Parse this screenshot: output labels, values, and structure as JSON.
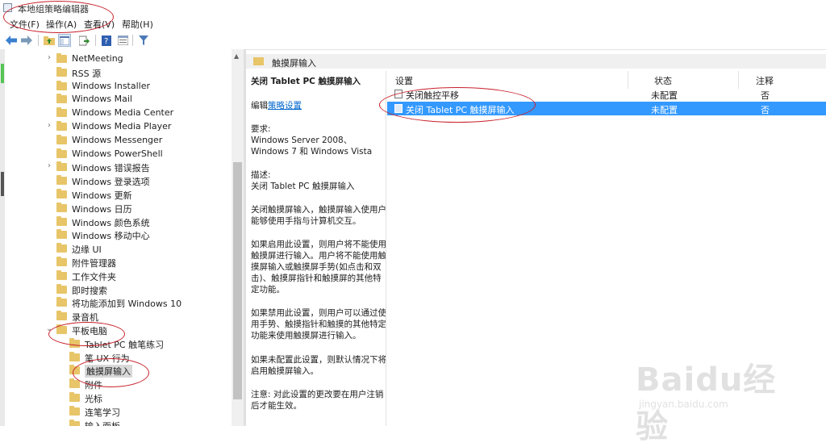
{
  "window": {
    "title": "本地组策略编辑器"
  },
  "menu": [
    "文件(F)",
    "操作(A)",
    "查看(V)",
    "帮助(H)"
  ],
  "toolbar": {
    "icons": [
      "back-arrow-icon",
      "forward-arrow-icon",
      "up-folder-icon",
      "show-tree-icon",
      "export-list-icon",
      "help-icon",
      "properties-icon",
      "filter-icon"
    ]
  },
  "tree": {
    "items": [
      {
        "label": "NetMeeting",
        "expander": "›"
      },
      {
        "label": "RSS 源",
        "expander": ""
      },
      {
        "label": "Windows Installer",
        "expander": ""
      },
      {
        "label": "Windows Mail",
        "expander": ""
      },
      {
        "label": "Windows Media Center",
        "expander": ""
      },
      {
        "label": "Windows Media Player",
        "expander": "›"
      },
      {
        "label": "Windows Messenger",
        "expander": ""
      },
      {
        "label": "Windows PowerShell",
        "expander": ""
      },
      {
        "label": "Windows 错误报告",
        "expander": "›"
      },
      {
        "label": "Windows 登录选项",
        "expander": ""
      },
      {
        "label": "Windows 更新",
        "expander": ""
      },
      {
        "label": "Windows 日历",
        "expander": ""
      },
      {
        "label": "Windows 颜色系统",
        "expander": ""
      },
      {
        "label": "Windows 移动中心",
        "expander": ""
      },
      {
        "label": "边缘 UI",
        "expander": ""
      },
      {
        "label": "附件管理器",
        "expander": ""
      },
      {
        "label": "工作文件夹",
        "expander": ""
      },
      {
        "label": "即时搜索",
        "expander": ""
      },
      {
        "label": "将功能添加到 Windows 10",
        "expander": ""
      },
      {
        "label": "录音机",
        "expander": ""
      },
      {
        "label": "平板电脑",
        "expander": "⌄"
      },
      {
        "label": "Tablet PC 触笔练习",
        "expander": ""
      },
      {
        "label": "笔 UX 行为",
        "expander": ""
      },
      {
        "label": "触摸屏输入",
        "expander": ""
      },
      {
        "label": "附件",
        "expander": ""
      },
      {
        "label": "光标",
        "expander": ""
      },
      {
        "label": "连笔学习",
        "expander": ""
      },
      {
        "label": "输入面板",
        "expander": ""
      }
    ]
  },
  "right_header": {
    "label": "触摸屏输入"
  },
  "description": {
    "title": "关闭 Tablet PC 触摸屏输入",
    "edit_prefix": "编辑",
    "edit_link": "策略设置",
    "requirements_label": "要求:",
    "requirements": "Windows Server 2008、Windows 7 和 Windows Vista",
    "desc_label": "描述:",
    "desc_line": "关闭 Tablet PC 触摸屏输入",
    "para1": "关闭触摸屏输入，触摸屏输入使用户能够使用手指与计算机交互。",
    "para2": "如果启用此设置，则用户将不能使用触摸屏进行输入。用户将不能使用触摸屏输入或触摸屏手势(如点击和双击)、触摸屏指针和触摸屏的其他特定功能。",
    "para3": "如果禁用此设置，则用户可以通过使用手势、触摸指针和触摸的其他特定功能来使用触摸屏进行输入。",
    "para4": "如果未配置此设置，则默认情况下将启用触摸屏输入。",
    "para5": "注意: 对此设置的更改要在用户注销后才能生效。"
  },
  "list": {
    "columns": [
      "设置",
      "状态",
      "注释"
    ],
    "rows": [
      {
        "name": "关闭触控平移",
        "status": "未配置",
        "comment": "否",
        "selected": false
      },
      {
        "name": "关闭 Tablet PC 触摸屏输入",
        "status": "未配置",
        "comment": "否",
        "selected": true
      }
    ]
  },
  "watermark": {
    "big": "Baidu经验",
    "small": "jingyan.baidu.com"
  },
  "colors": {
    "selection": "#3399ff",
    "annotation": "#c8212c",
    "folder": "#e7c568"
  }
}
